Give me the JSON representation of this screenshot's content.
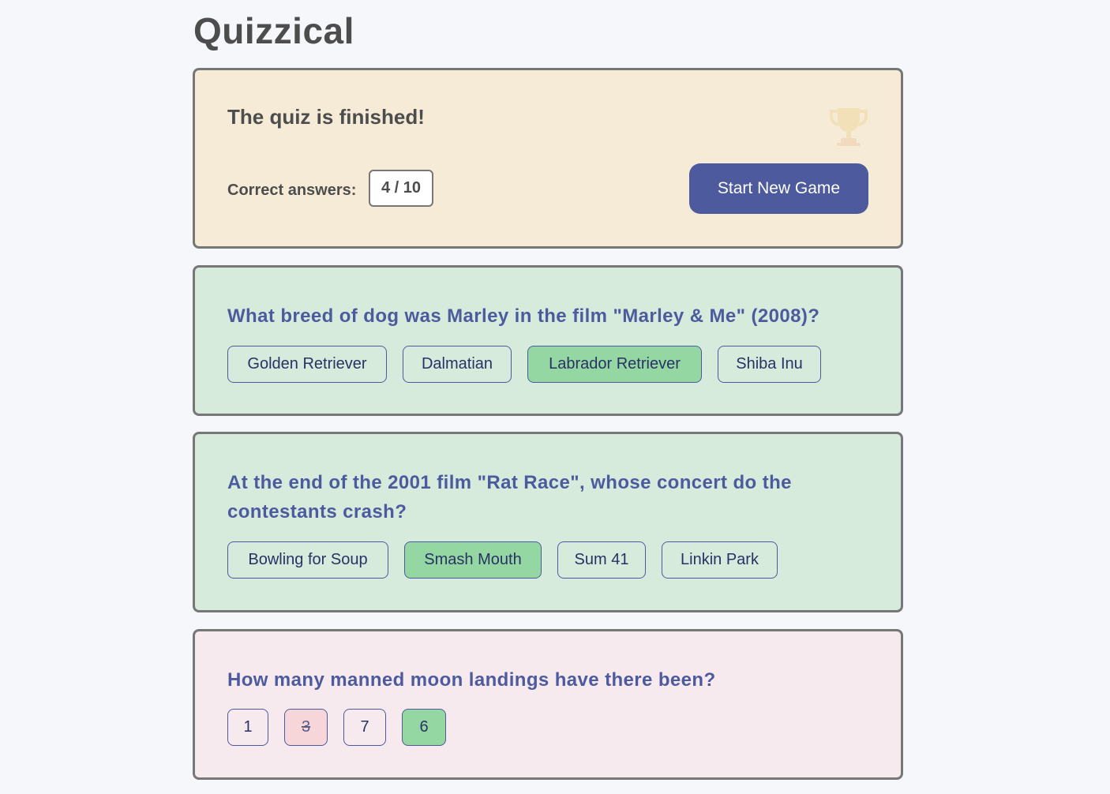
{
  "app": {
    "title": "Quizzical"
  },
  "result": {
    "heading": "The quiz is finished!",
    "score_label": "Correct answers:",
    "score_value": "4 / 10",
    "new_game_label": "Start New Game",
    "icon": "trophy-icon"
  },
  "questions": [
    {
      "text": "What breed of dog was Marley in the film \"Marley & Me\" (2008)?",
      "status": "correct",
      "answers": [
        "Golden Retriever",
        "Dalmatian",
        "Labrador Retriever",
        "Shiba Inu"
      ],
      "correct_answer": "Labrador Retriever",
      "selected_answer": "Labrador Retriever"
    },
    {
      "text": "At the end of the 2001 film \"Rat Race\", whose concert do the contestants crash?",
      "status": "correct",
      "answers": [
        "Bowling for Soup",
        "Smash Mouth",
        "Sum 41",
        "Linkin Park"
      ],
      "correct_answer": "Smash Mouth",
      "selected_answer": "Smash Mouth"
    },
    {
      "text": "How many manned moon landings have there been?",
      "status": "wrong",
      "answers": [
        "1",
        "3",
        "7",
        "6"
      ],
      "correct_answer": "6",
      "selected_answer": "3"
    }
  ],
  "colors": {
    "accent": "#4d5b9e",
    "correct_bg": "#94d7a2",
    "wrong_bg": "#f7d6da",
    "result_card_bg": "#f6ebd6",
    "correct_card_bg": "#d6ebdc",
    "wrong_card_bg": "#f6eaee"
  }
}
